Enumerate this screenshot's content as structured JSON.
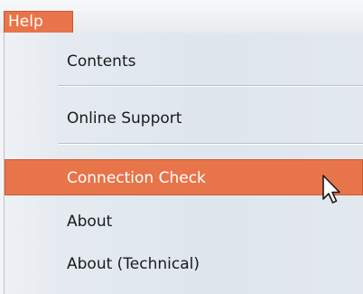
{
  "menubar": {
    "help_label": "Help"
  },
  "menu": {
    "items": [
      {
        "label": "Contents"
      },
      {
        "label": "Online Support"
      },
      {
        "label": "Connection Check"
      },
      {
        "label": "About"
      },
      {
        "label": "About (Technical)"
      }
    ]
  },
  "colors": {
    "accent": "#e8744a",
    "menu_bg": "#e3e8ef",
    "separator": "#b7c1cc"
  },
  "pointer": {
    "icon": "mouse-pointer-icon",
    "hovered_item": "Connection Check"
  }
}
